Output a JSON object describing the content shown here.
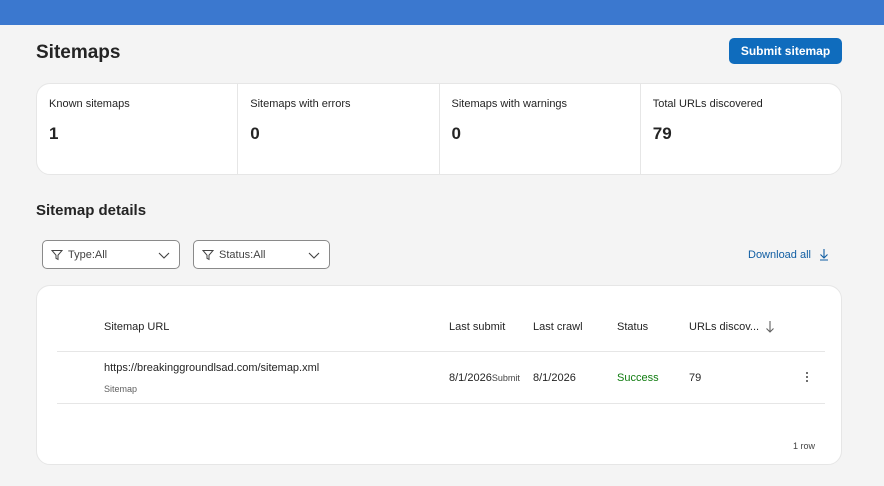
{
  "page": {
    "title": "Sitemaps",
    "submit_button": "Submit sitemap"
  },
  "stats": [
    {
      "label": "Known sitemaps",
      "value": "1"
    },
    {
      "label": "Sitemaps with errors",
      "value": "0"
    },
    {
      "label": "Sitemaps with warnings",
      "value": "0"
    },
    {
      "label": "Total URLs discovered",
      "value": "79"
    }
  ],
  "details": {
    "title": "Sitemap details",
    "filters": {
      "type": "Type:All",
      "status": "Status:All"
    },
    "download_label": "Download all",
    "table": {
      "columns": [
        "Sitemap URL",
        "Last submit",
        "Last crawl",
        "Status",
        "URLs discov..."
      ],
      "rows": [
        {
          "url": "https://breakinggroundlsad.com/sitemap.xml",
          "type": "Sitemap",
          "last_submit": "8/1/2026",
          "last_submit_suffix": "Submit",
          "last_crawl": "8/1/2026",
          "status": "Success",
          "urls_discovered": "79"
        }
      ],
      "row_count": "1 row"
    }
  },
  "colors": {
    "top_bar": "#3b78cf",
    "primary_button": "#0f6cbd",
    "link": "#115ea3",
    "success": "#107c10"
  },
  "icons": {
    "filter": "funnel-icon",
    "dropdown": "chevron-down-icon",
    "download": "arrow-down-icon",
    "sort": "arrow-down-icon",
    "more": "more-vertical-icon"
  }
}
